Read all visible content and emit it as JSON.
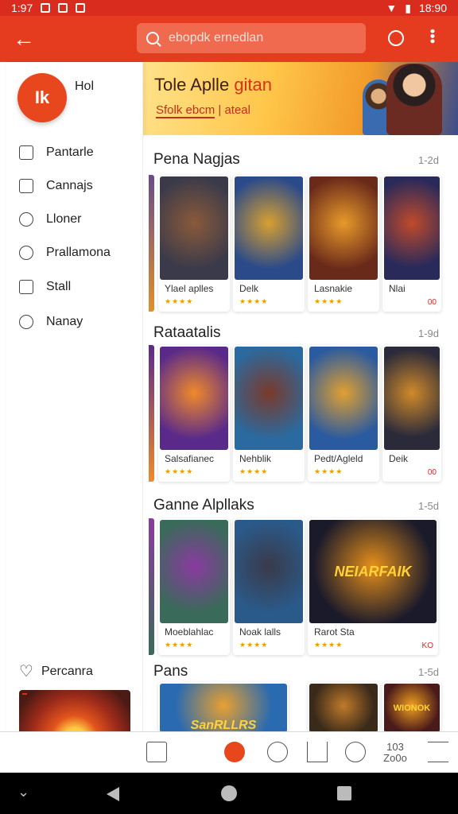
{
  "status_bar": {
    "time": "1:97",
    "clock": "18:90"
  },
  "app_bar": {
    "search_text": "ebopdk ernedlan"
  },
  "banner": {
    "title_prefix": "Tole Aplle",
    "title_highlight": "gitan",
    "sub_underlined": "Sfolk ebcm",
    "sub_rest": "| ateal"
  },
  "drawer": {
    "avatar_initials": "Ik",
    "user_label": "Hol",
    "items": [
      {
        "label": "Pantarle",
        "icon": "edit-icon"
      },
      {
        "label": "Cannajs",
        "icon": "cloud-icon"
      },
      {
        "label": "Lloner",
        "icon": "timer-icon"
      },
      {
        "label": "Prallamona",
        "icon": "clock-icon"
      },
      {
        "label": "Stall",
        "icon": "info-icon"
      },
      {
        "label": "Nanay",
        "icon": "globe-icon"
      }
    ],
    "favorites_label": "Percanra"
  },
  "sections": [
    {
      "title": "Pena Nagjas",
      "more": "1-2d",
      "cards": [
        {
          "name": "Ylael aplles",
          "stars": "★★★★",
          "extra": "",
          "colors": [
            "#3a3a4a",
            "#8a5a3a"
          ]
        },
        {
          "name": "Delk",
          "stars": "★★★★",
          "extra": "",
          "colors": [
            "#2a4a8a",
            "#d8a030"
          ]
        },
        {
          "name": "Lasnakie",
          "stars": "★★★★",
          "extra": "",
          "colors": [
            "#6a2a1a",
            "#e89a2a"
          ]
        },
        {
          "name": "Nlai",
          "stars": "",
          "extra": "00",
          "colors": [
            "#2a2a5a",
            "#c04a2a"
          ]
        }
      ]
    },
    {
      "title": "Rataatalis",
      "more": "1-9d",
      "cards": [
        {
          "name": "Salsafianec",
          "stars": "★★★★",
          "extra": "",
          "colors": [
            "#5a2a8a",
            "#f08a2a"
          ]
        },
        {
          "name": "Nehblik",
          "stars": "★★★★",
          "extra": "",
          "colors": [
            "#2a6aa0",
            "#7a3a2a"
          ]
        },
        {
          "name": "Pedt/Agleld",
          "stars": "★★★★",
          "extra": "",
          "colors": [
            "#2a5aa0",
            "#e0a030"
          ]
        },
        {
          "name": "Deik",
          "stars": "",
          "extra": "00",
          "colors": [
            "#2a2a3a",
            "#d08a2a"
          ]
        }
      ]
    },
    {
      "title": "Ganne Alpllaks",
      "more": "1-5d",
      "cards": [
        {
          "name": "Moeblahlac",
          "stars": "★★★★",
          "extra": "",
          "colors": [
            "#3a6a5a",
            "#8a3aa0"
          ]
        },
        {
          "name": "Noak lalls",
          "stars": "★★★★",
          "extra": "",
          "colors": [
            "#2a5a8a",
            "#3a3a4a"
          ]
        },
        {
          "name": "Rarot Sta",
          "stars": "★★★★",
          "extra": "KO",
          "title_art": "NEIARFAIK",
          "colors": [
            "#1a1a2a",
            "#e8901a"
          ]
        }
      ]
    },
    {
      "title": "Pans",
      "more": "1-5d",
      "cards": [
        {
          "name": "",
          "stars": "",
          "extra": "",
          "title_art": "SanRLLRS",
          "colors": [
            "#2a6ab0",
            "#e8a030"
          ]
        },
        {
          "name": "",
          "stars": "",
          "extra": "",
          "colors": [
            "#3a2a1a",
            "#c07a2a"
          ]
        },
        {
          "name": "",
          "stars": "",
          "extra": "",
          "title_art": "WIONOK",
          "colors": [
            "#4a1a1a",
            "#f0a020"
          ]
        }
      ]
    }
  ],
  "bottom_nav": {
    "zoom_label_top": "103",
    "zoom_label_bottom": "Zo0o"
  }
}
